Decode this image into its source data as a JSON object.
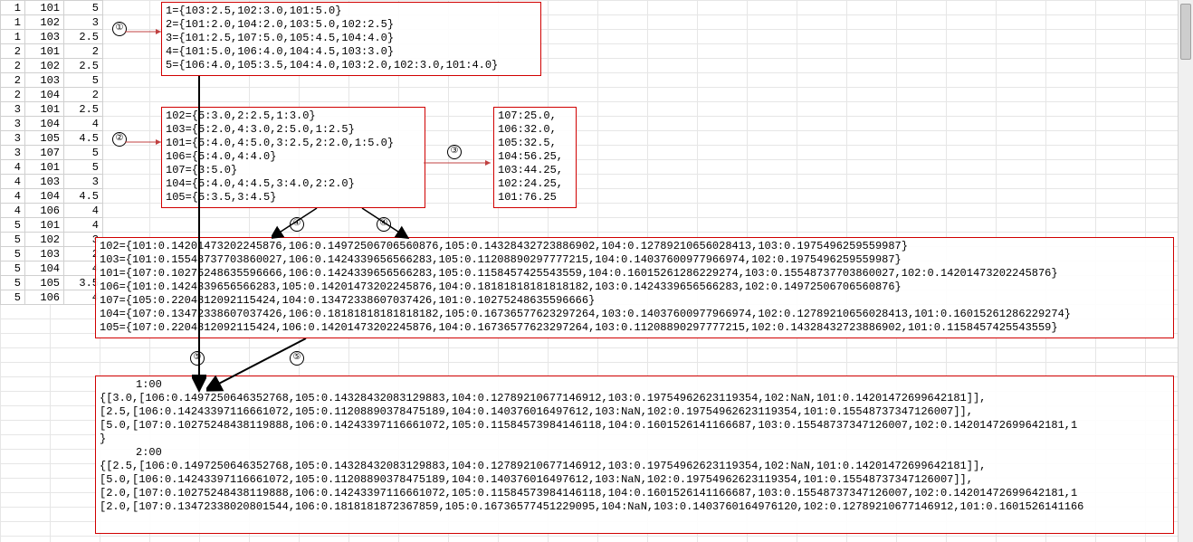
{
  "table": {
    "cols": [
      "1",
      "101",
      "5"
    ],
    "rows": [
      [
        "1",
        "101",
        "5"
      ],
      [
        "1",
        "102",
        "3"
      ],
      [
        "1",
        "103",
        "2.5"
      ],
      [
        "2",
        "101",
        "2"
      ],
      [
        "2",
        "102",
        "2.5"
      ],
      [
        "2",
        "103",
        "5"
      ],
      [
        "2",
        "104",
        "2"
      ],
      [
        "3",
        "101",
        "2.5"
      ],
      [
        "3",
        "104",
        "4"
      ],
      [
        "3",
        "105",
        "4.5"
      ],
      [
        "3",
        "107",
        "5"
      ],
      [
        "4",
        "101",
        "5"
      ],
      [
        "4",
        "103",
        "3"
      ],
      [
        "4",
        "104",
        "4.5"
      ],
      [
        "4",
        "106",
        "4"
      ],
      [
        "5",
        "101",
        "4"
      ],
      [
        "5",
        "102",
        "3"
      ],
      [
        "5",
        "103",
        "2"
      ],
      [
        "5",
        "104",
        "4"
      ],
      [
        "5",
        "105",
        "3.5"
      ],
      [
        "5",
        "106",
        "4"
      ]
    ]
  },
  "box1": {
    "lines": [
      "1={103:2.5,102:3.0,101:5.0}",
      "2={101:2.0,104:2.0,103:5.0,102:2.5}",
      "3={101:2.5,107:5.0,105:4.5,104:4.0}",
      "4={101:5.0,106:4.0,104:4.5,103:3.0}",
      "5={106:4.0,105:3.5,104:4.0,103:2.0,102:3.0,101:4.0}"
    ]
  },
  "box2": {
    "lines": [
      "102={5:3.0,2:2.5,1:3.0}",
      "103={5:2.0,4:3.0,2:5.0,1:2.5}",
      "101={5:4.0,4:5.0,3:2.5,2:2.0,1:5.0}",
      "106={5:4.0,4:4.0}",
      "107={3:5.0}",
      "104={5:4.0,4:4.5,3:4.0,2:2.0}",
      "105={5:3.5,3:4.5}"
    ]
  },
  "box3": {
    "lines": [
      "107:25.0,",
      "106:32.0,",
      "105:32.5,",
      "104:56.25,",
      "103:44.25,",
      "102:24.25,",
      "101:76.25"
    ]
  },
  "box4": {
    "lines": [
      "102={101:0.14201473202245876,106:0.1497250670656087᠎6,105:0.14328432723886902,104:0.12789210656028413,103:0.1975496259559987}",
      "103={101:0.15548737703860027,106:0.1424339656566283,105:0.11208890297777215,104:0.14037600977966974,102:0.1975496259559987}",
      "101={107:0.10275248635596666,106:0.1424339656566283,105:0.1158457425543559,104:0.16015261286229274,103:0.15548737703860027,102:0.14201473202245876}",
      "106={101:0.1424339656566283,105:0.14201473202245876,104:0.1818181818181818​2,103:0.1424339656566283,102:0.1497250670656087᠎6}",
      "107={105:0.22048120921154᠎24,104:0.13472338607037426,101:0.10275248635596666}",
      "104={107:0.13472338607037426,106:0.1818181818181818​2,105:0.16736577623297264,103:0.14037600977966974,102:0.12789210656028413,101:0.16015261286229274}",
      "105={107:0.22048120921154᠎24,106:0.14201473202245876,104:0.16736577623297264,103:0.11208890297777215,102:0.14328432723886902,101:0.1158457425543559}"
    ]
  },
  "box5": {
    "h1": "1:00",
    "b1": [
      "{[3.0,[106:0.14972506463527᠎68,105:0.14328432083129883,104:0.12789210677146912,103:0.19754962623119354,102:NaN,101:0.14201472699642181]],",
      "[2.5,[106:0.14243397116661072,105:0.11208890378475189,104:0.140376016497612,103:NaN,102:0.19754962623119354,101:0.15548737347126007]],",
      "[5.0,[107:0.10275248438119888,106:0.14243397116661072,105:0.11584573984146118,104:0.1601526141166687,103:0.15548737347126007,102:0.14201472699642181,1",
      "}"
    ],
    "h2": "2:00",
    "b2": [
      "{[2.5,[106:0.14972506463527᠎68,105:0.14328432083129883,104:0.12789210677146912,103:0.19754962623119354,102:NaN,101:0.14201472699642181]],",
      "[5.0,[106:0.14243397116661072,105:0.11208890378475189,104:0.140376016497612,103:NaN,102:0.19754962623119354,101:0.15548737347126007]],",
      "[2.0,[107:0.10275248438119888,106:0.14243397116661072,105:0.11584573984146118,104:0.1601526141166687,103:0.15548737347126007,102:0.14201472699642181,1",
      "[2.0,[107:0.13472338020801544,106:0.1818181872367859᠎,105:0.16736577451229095,104:NaN,103:0.1403760164976120,102:0.12789210677146912,101:0.1601526141166"
    ]
  },
  "labels": {
    "l1": "①",
    "l2": "②",
    "l3": "③",
    "l4a": "④",
    "l4b": "④",
    "l5a": "⑤",
    "l5b": "⑤"
  }
}
